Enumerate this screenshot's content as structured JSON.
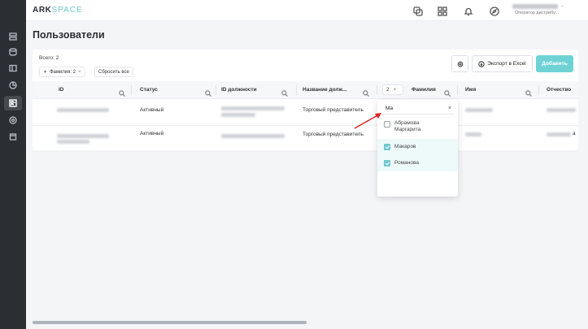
{
  "logo": {
    "part1": "ARK",
    "part2": "SPACE"
  },
  "header": {
    "user_dash": "-",
    "user_role": "Оператор дистрибу..."
  },
  "page": {
    "title": "Пользователи"
  },
  "toolbar": {
    "total_label": "Всего: 2",
    "filter_chip": "Фамилия: 2",
    "filter_chip_close": "×",
    "reset_label": "Сбросить все",
    "export_label": "Экспорт в Excel",
    "add_label": "Добавить"
  },
  "table": {
    "columns": [
      "ID",
      "Статус",
      "ID должности",
      "Название долж...",
      "Фамилия",
      "Имя",
      "Отчество"
    ],
    "lastname_filter_count": "2",
    "lastname_filter_close": "×",
    "rows": [
      {
        "status": "Активный",
        "position_name": "Торговый представитель"
      },
      {
        "status": "Активный",
        "position_name": "Торговый представитель",
        "patronymic_tail": "а"
      }
    ]
  },
  "dropdown": {
    "search_value": "Ма",
    "clear": "×",
    "items": [
      {
        "label_line1": "Абрамова",
        "label_line2": "Маргарита",
        "checked": false
      },
      {
        "label_line1": "Макаров",
        "label_line2": "",
        "checked": true
      },
      {
        "label_line1": "Романова",
        "label_line2": "",
        "checked": true
      }
    ]
  },
  "icons": {
    "sidebar": [
      "list-icon",
      "database-icon",
      "panel-icon",
      "chart-icon",
      "users-icon",
      "settings-icon",
      "calendar-icon"
    ],
    "header": [
      "help-icon",
      "apps-icon",
      "bell-icon",
      "compass-icon"
    ]
  },
  "colors": {
    "accent": "#6fd3d6",
    "sidebar": "#2b2e33",
    "annotation": "#e02020"
  }
}
